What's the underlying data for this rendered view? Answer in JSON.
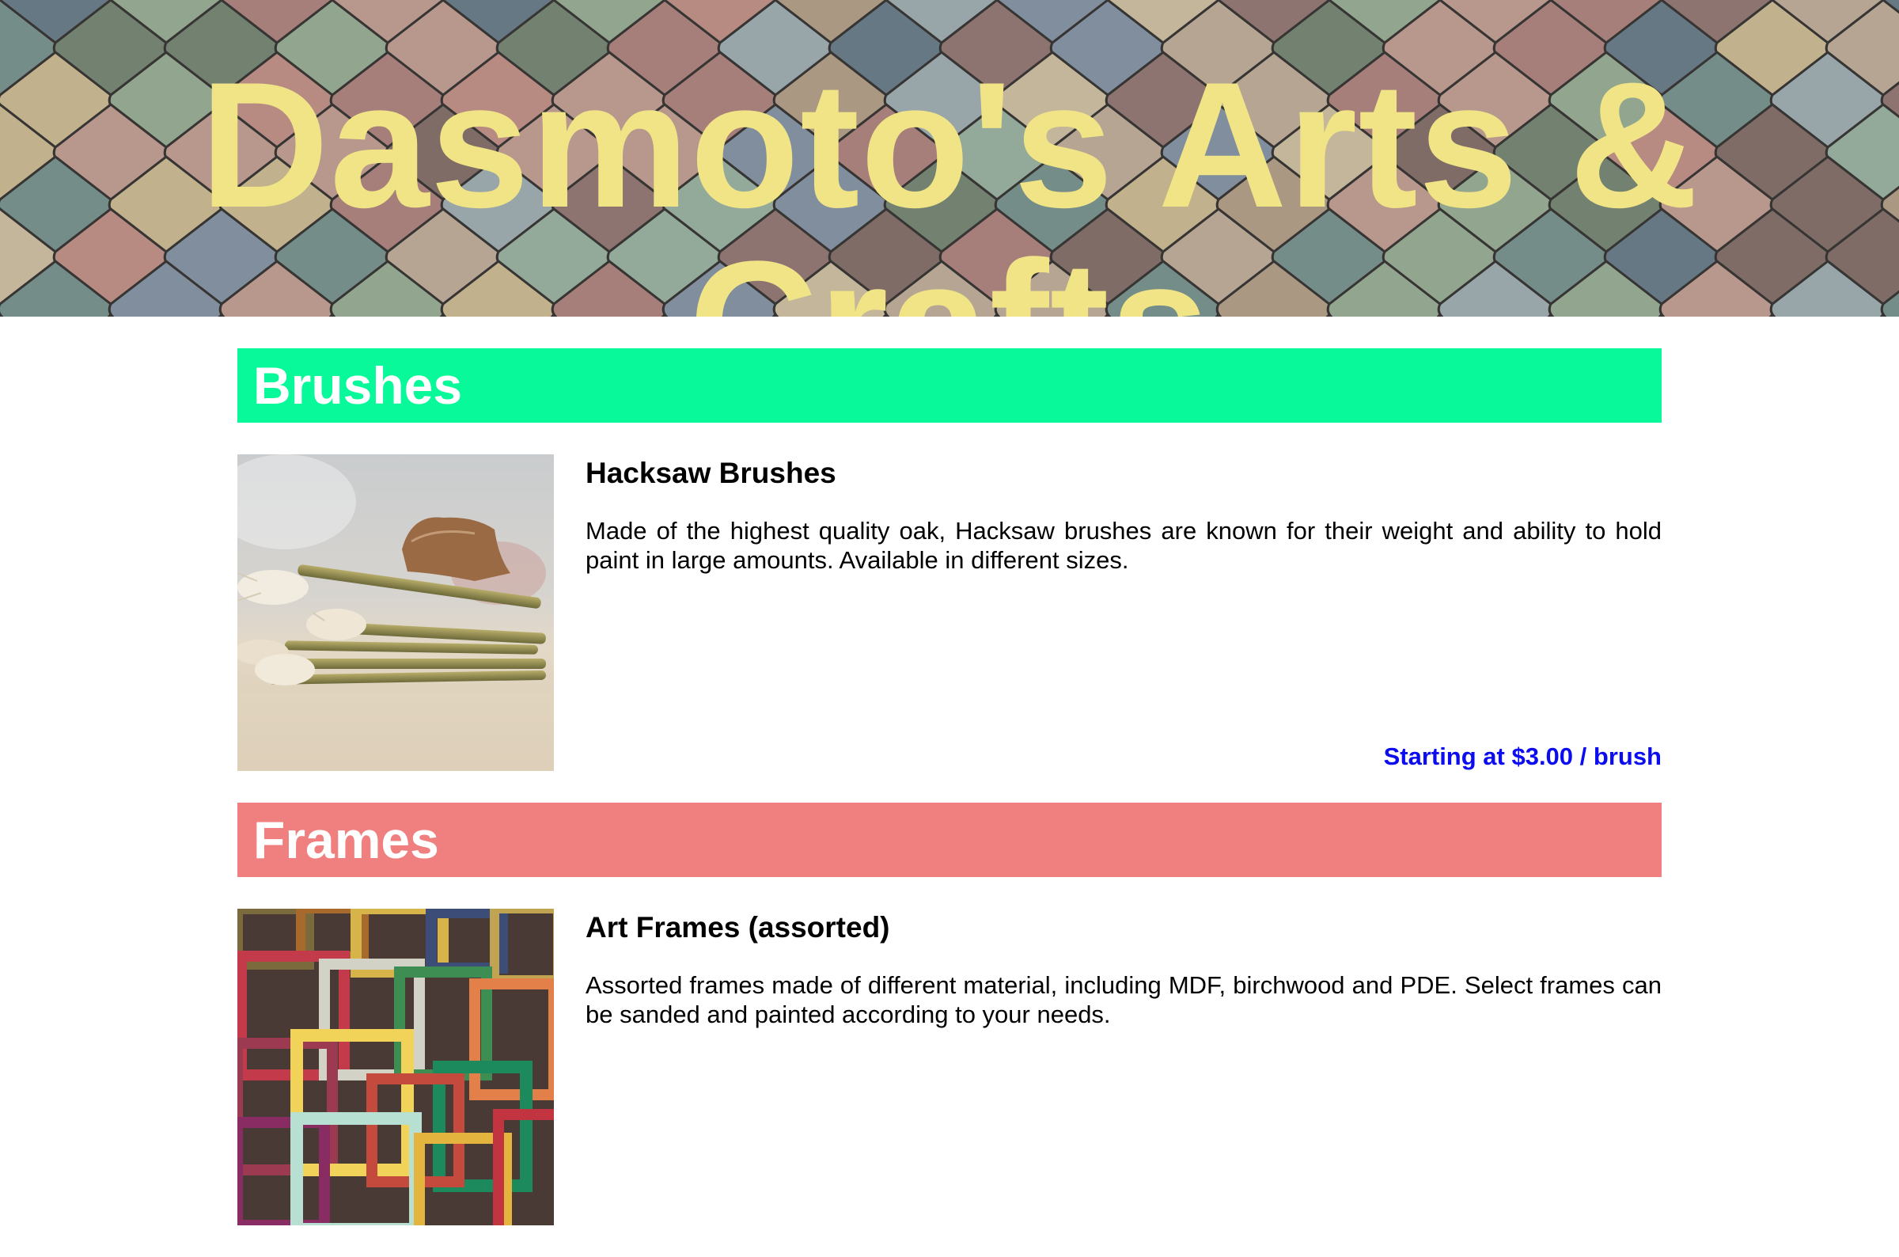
{
  "header": {
    "title": "Dasmoto's Arts & Crafts"
  },
  "colors": {
    "title": "#f0e486",
    "brushes_header": "#08f99a",
    "frames_header": "#ef807f",
    "price": "#0c0cf0"
  },
  "sections": [
    {
      "heading": "Brushes",
      "item": {
        "image": "brushes-photo",
        "title": "Hacksaw Brushes",
        "description": "Made of the highest quality oak, Hacksaw brushes are known for their weight and ability to hold paint in large amounts. Available in different sizes.",
        "price": "Starting at $3.00 / brush"
      }
    },
    {
      "heading": "Frames",
      "item": {
        "image": "frames-photo",
        "title": "Art Frames (assorted)",
        "description": "Assorted frames made of different material, including MDF, birchwood and PDE. Select frames can be sanded and painted according to your needs."
      }
    }
  ]
}
